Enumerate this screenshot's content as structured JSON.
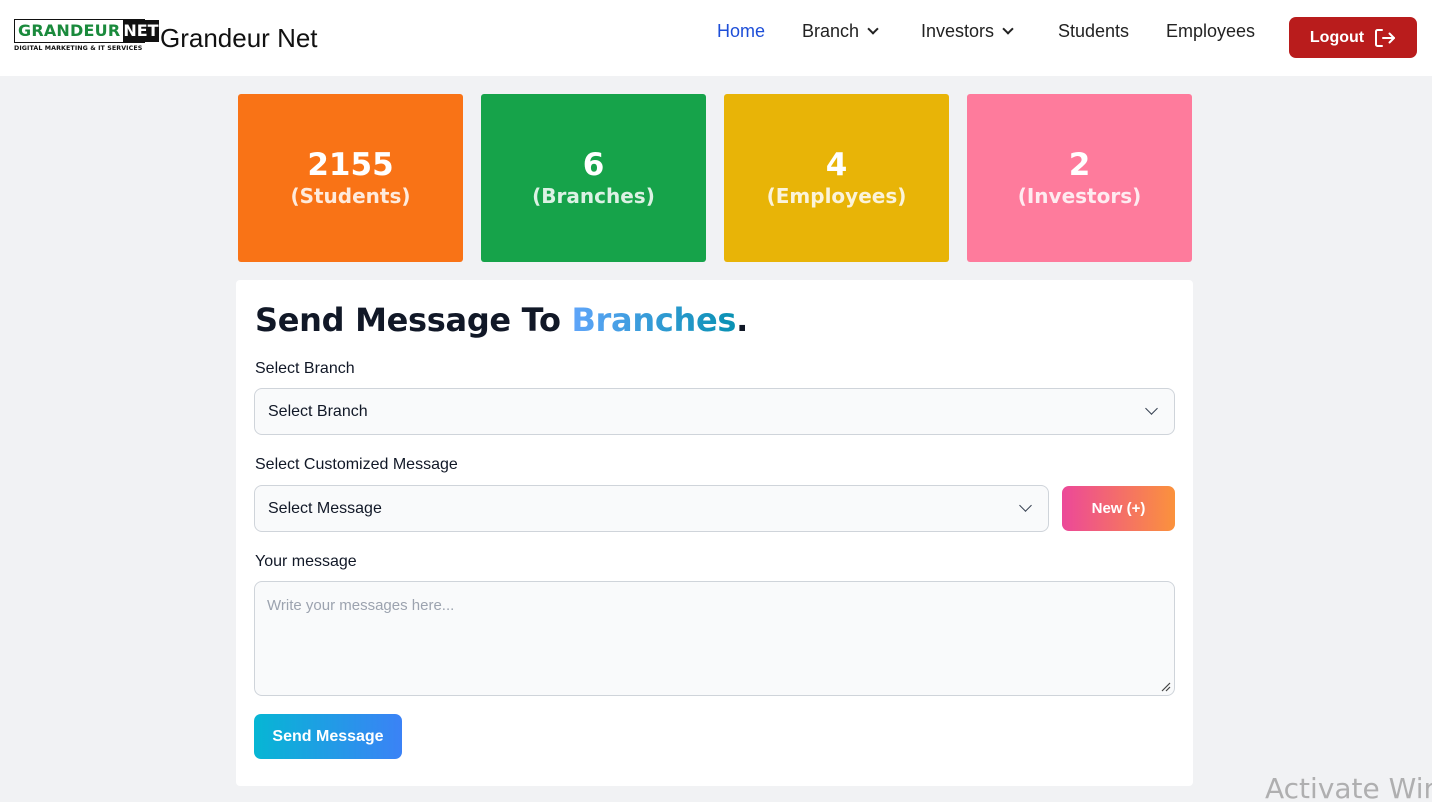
{
  "brand": {
    "logo_main": "GRANDEUR",
    "logo_accent": "NET",
    "logo_tagline": "DIGITAL MARKETING & IT SERVICES",
    "name": "Grandeur Net"
  },
  "nav": {
    "items": [
      {
        "label": "Home",
        "active": true
      },
      {
        "label": "Branch",
        "dropdown": true
      },
      {
        "label": "Investors",
        "dropdown": true
      },
      {
        "label": "Students"
      },
      {
        "label": "Employees"
      }
    ],
    "logout_label": "Logout",
    "logout_icon": "logout-icon"
  },
  "stats": [
    {
      "value": "2155",
      "label": "(Students)",
      "color": "#f97316"
    },
    {
      "value": "6",
      "label": "(Branches)",
      "color": "#16a34a"
    },
    {
      "value": "4",
      "label": "(Employees)",
      "color": "#e8b407"
    },
    {
      "value": "2",
      "label": "(Investors)",
      "color": "#fe7b9c"
    }
  ],
  "form": {
    "title_prefix": "Send Message To ",
    "title_accent": "Branches",
    "title_suffix": ".",
    "branch_label": "Select Branch",
    "branch_value": "Select Branch",
    "message_select_label": "Select Customized Message",
    "message_select_value": "Select Message",
    "new_button": "New (+)",
    "message_label": "Your message",
    "message_placeholder": "Write your messages here...",
    "send_button": "Send Message"
  },
  "watermark": "Activate Wind"
}
